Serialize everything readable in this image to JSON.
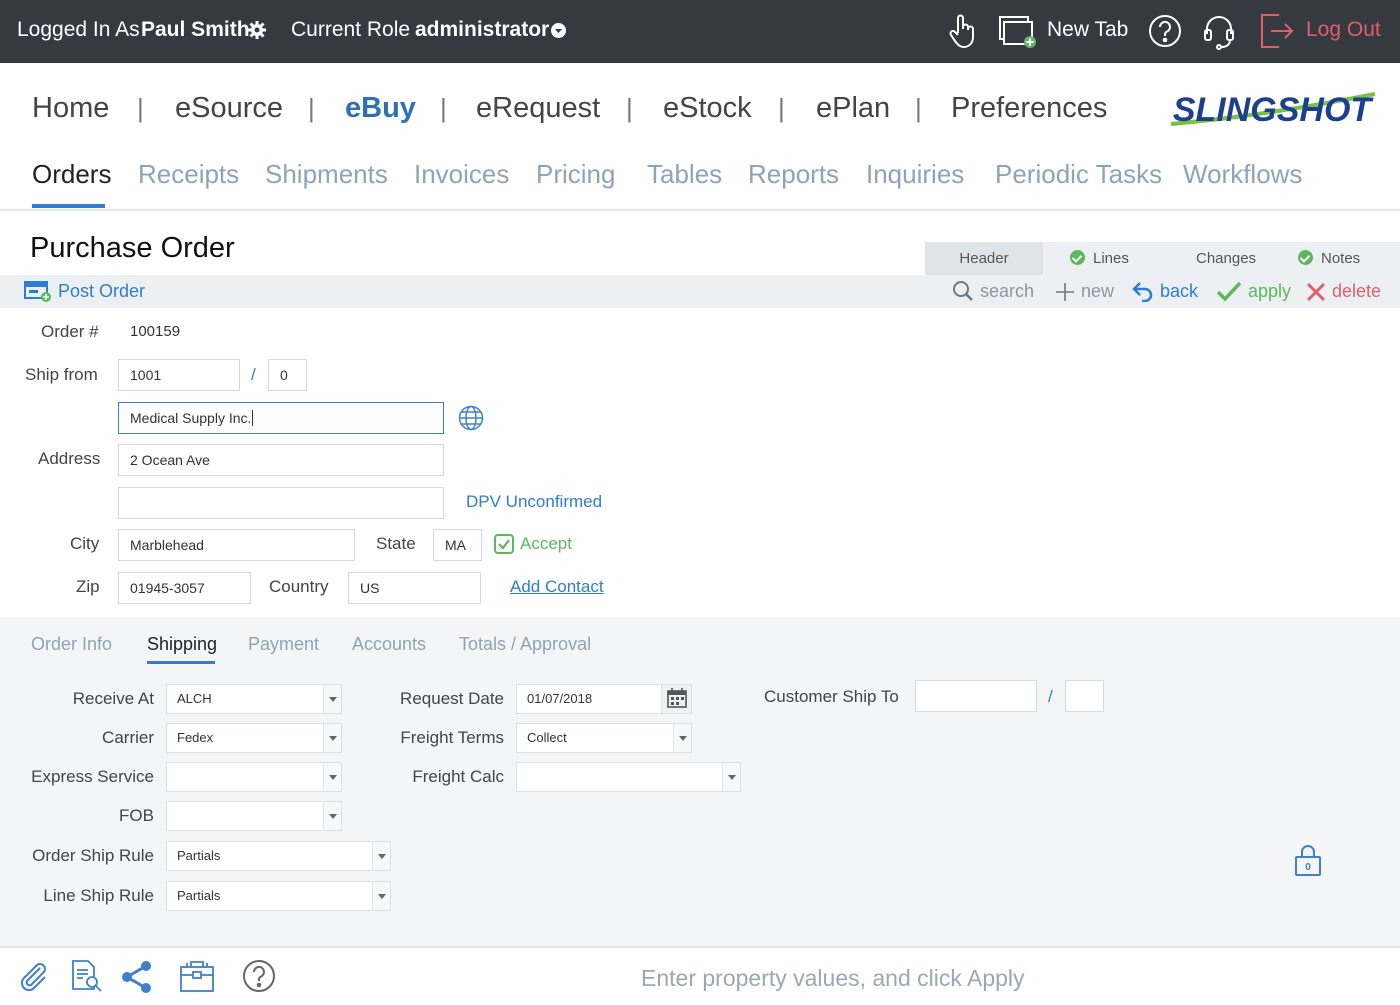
{
  "topbar": {
    "logged_in_label": "Logged In As",
    "user_name": "Paul Smith",
    "role_label": "Current Role",
    "role_value": "administrator",
    "new_tab": "New Tab",
    "logout": "Log Out"
  },
  "main_nav": {
    "items": [
      "Home",
      "eSource",
      "eBuy",
      "eRequest",
      "eStock",
      "ePlan",
      "Preferences"
    ],
    "separator": "|",
    "active": "eBuy"
  },
  "logo": "SLINGSHOT",
  "sub_nav": {
    "items": [
      "Orders",
      "Receipts",
      "Shipments",
      "Invoices",
      "Pricing",
      "Tables",
      "Reports",
      "Inquiries",
      "Periodic Tasks",
      "Workflows"
    ],
    "active": "Orders"
  },
  "page": {
    "title": "Purchase Order",
    "right_tabs": [
      "Header",
      "Lines",
      "Changes",
      "Notes"
    ],
    "active_right_tab": "Header"
  },
  "toolbar": {
    "post_order": "Post Order",
    "search": "search",
    "new": "new",
    "back": "back",
    "apply": "apply",
    "delete": "delete"
  },
  "form": {
    "order_label": "Order #",
    "order_value": "100159",
    "ship_from_label": "Ship from",
    "ship_from_value": "1001",
    "ship_from_slash": "/",
    "ship_from_suffix": "0",
    "name_value": "Medical Supply Inc.",
    "address_label": "Address",
    "address1": "2 Ocean Ave",
    "address2": "",
    "dpv": "DPV Unconfirmed",
    "city_label": "City",
    "city_value": "Marblehead",
    "state_label": "State",
    "state_value": "MA",
    "accept": "Accept",
    "zip_label": "Zip",
    "zip_value": "01945-3057",
    "country_label": "Country",
    "country_value": "US",
    "add_contact": "Add Contact"
  },
  "lower_tabs": {
    "items": [
      "Order Info",
      "Shipping",
      "Payment",
      "Accounts",
      "Totals / Approval"
    ],
    "active": "Shipping"
  },
  "shipping": {
    "receive_at_label": "Receive At",
    "receive_at_value": "ALCH",
    "carrier_label": "Carrier",
    "carrier_value": "Fedex",
    "express_label": "Express Service",
    "express_value": "",
    "fob_label": "FOB",
    "fob_value": "",
    "order_ship_rule_label": "Order Ship Rule",
    "order_ship_rule_value": "Partials",
    "line_ship_rule_label": "Line Ship Rule",
    "line_ship_rule_value": "Partials",
    "request_date_label": "Request Date",
    "request_date_value": "01/07/2018",
    "freight_terms_label": "Freight Terms",
    "freight_terms_value": "Collect",
    "freight_calc_label": "Freight Calc",
    "freight_calc_value": "",
    "customer_ship_to_label": "Customer Ship To",
    "customer_ship_to_slash": "/",
    "lock_count": "0"
  },
  "footer": {
    "message": "Enter property values, and click Apply"
  },
  "colors": {
    "topbar_bg": "#343a40",
    "accent_blue": "#2f7dd2",
    "logout_red": "#e35d6a",
    "apply_green": "#5cb85c"
  }
}
